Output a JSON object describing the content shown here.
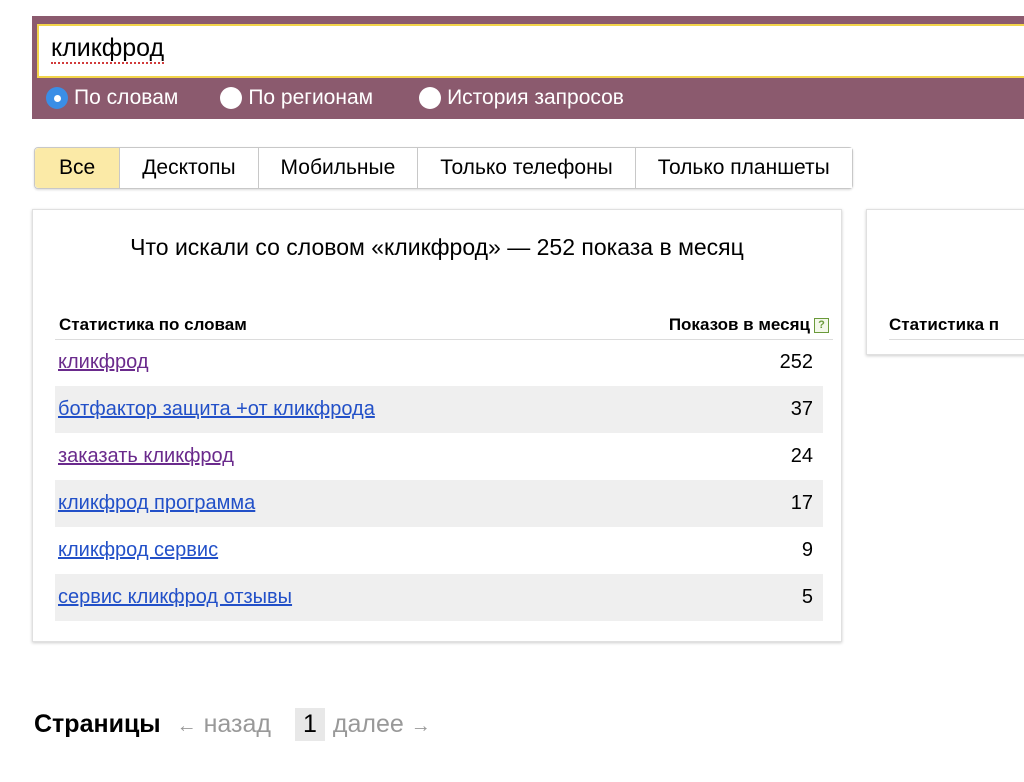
{
  "search": {
    "query": "кликфрод"
  },
  "modes": [
    {
      "label": "По словам",
      "selected": true
    },
    {
      "label": "По регионам",
      "selected": false
    },
    {
      "label": "История запросов",
      "selected": false
    }
  ],
  "device_tabs": [
    {
      "label": "Все",
      "active": true
    },
    {
      "label": "Десктопы",
      "active": false
    },
    {
      "label": "Мобильные",
      "active": false
    },
    {
      "label": "Только телефоны",
      "active": false
    },
    {
      "label": "Только планшеты",
      "active": false
    }
  ],
  "stats": {
    "title": "Что искали со словом «кликфрод» — 252 показа в месяц",
    "col_words": "Статистика по словам",
    "col_shows": "Показов в месяц",
    "help_icon": "?",
    "rows": [
      {
        "phrase": "кликфрод",
        "count": "252",
        "visited": true
      },
      {
        "phrase": "ботфактор защита +от кликфрода",
        "count": "37",
        "visited": false
      },
      {
        "phrase": "заказать кликфрод",
        "count": "24",
        "visited": true
      },
      {
        "phrase": "кликфрод программа",
        "count": "17",
        "visited": false
      },
      {
        "phrase": "кликфрод сервис",
        "count": "9",
        "visited": false
      },
      {
        "phrase": "сервис кликфрод отзывы",
        "count": "5",
        "visited": false
      }
    ]
  },
  "right_panel": {
    "col_header": "Статистика п"
  },
  "pager": {
    "label": "Страницы",
    "prev_arrow": "←",
    "prev": "назад",
    "current": "1",
    "next": "далее",
    "next_arrow": "→"
  },
  "colors": {
    "band": "#8b5a6e",
    "active_tab": "#fbeaa7",
    "link": "#2250c8",
    "visited_link": "#6a2a8c"
  }
}
